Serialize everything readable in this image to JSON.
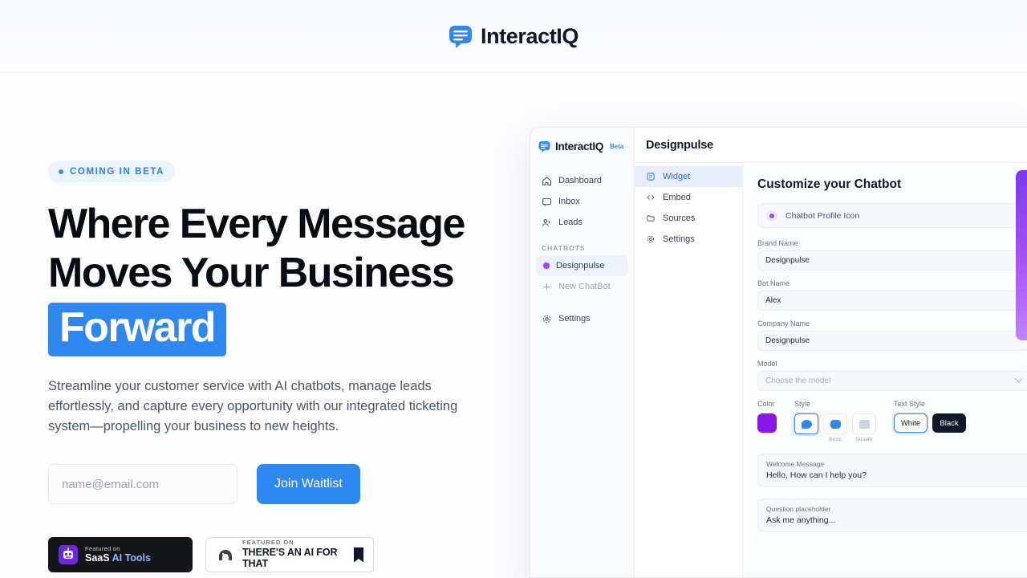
{
  "header": {
    "brand_name": "InteractIQ",
    "logo_icon": "chat-bubble-logo-icon",
    "logo_color": "#2f88f0"
  },
  "hero": {
    "badge": {
      "label": "COMING IN BETA",
      "dot_color": "#3b8ef0",
      "bg_color": "#eaf3fe",
      "text_color": "#2f7fe4"
    },
    "headline_line1": "Where Every Message",
    "headline_line2": "Moves Your Business",
    "headline_highlight": "Forward",
    "highlight_color": "#2f88f0",
    "subheadline": "Streamline your customer service with AI chatbots, manage leads effortlessly, and capture every opportunity with our integrated ticketing system—propelling your business to new heights.",
    "email_placeholder": "name@email.com",
    "email_value": "",
    "cta_label": "Join Waitlist",
    "cta_color": "#2f88f0"
  },
  "badges": [
    {
      "id": "saas-ai-tools",
      "icon": "robot-icon",
      "top_text": "Featured on",
      "main_text": "SaaS",
      "accent_text": "AI Tools",
      "theme": "dark"
    },
    {
      "id": "theres-an-ai-for-that",
      "icon": "elephant-icon",
      "top_text": "FEATURED ON",
      "main_text": "THERE'S AN AI FOR THAT",
      "theme": "light",
      "bookmark_icon": "bookmark-icon"
    }
  ],
  "app_preview": {
    "brand_name": "InteractIQ",
    "brand_badge": "Beta",
    "logo_icon": "chat-bubble-logo-icon",
    "sidebar": {
      "items": [
        {
          "label": "Dashboard",
          "icon": "home-icon",
          "state": "default"
        },
        {
          "label": "Inbox",
          "icon": "inbox-icon",
          "state": "default"
        },
        {
          "label": "Leads",
          "icon": "users-icon",
          "state": "default"
        }
      ],
      "group_label": "CHATBOTS",
      "chatbots": [
        {
          "label": "Designpulse",
          "icon": "chatbot-dot-icon",
          "state": "active"
        },
        {
          "label": "New ChatBot",
          "icon": "plus-icon",
          "state": "muted"
        }
      ],
      "footer_item": {
        "label": "Settings",
        "icon": "gear-icon"
      }
    },
    "topbar": {
      "title": "Designpulse"
    },
    "subnav": [
      {
        "label": "Widget",
        "icon": "widget-icon",
        "state": "active"
      },
      {
        "label": "Embed",
        "icon": "code-icon",
        "state": "default"
      },
      {
        "label": "Sources",
        "icon": "folder-icon",
        "state": "default"
      },
      {
        "label": "Settings",
        "icon": "gear-icon",
        "state": "default"
      }
    ],
    "main": {
      "title": "Customize your Chatbot",
      "profile_row_label": "Chatbot Profile Icon",
      "fields": [
        {
          "label": "Brand Name",
          "value": "Designpulse",
          "placeholder": ""
        },
        {
          "label": "Bot Name",
          "value": "Alex",
          "placeholder": ""
        },
        {
          "label": "Company Name",
          "value": "Designpulse",
          "placeholder": ""
        }
      ],
      "model_field": {
        "label": "Model",
        "value": "",
        "placeholder": "Choose the model"
      },
      "color_label": "Color",
      "color_value": "#8b16e8",
      "style_label": "Style",
      "style_options": [
        {
          "caption": "",
          "selected": true
        },
        {
          "caption": "Basic",
          "selected": false
        },
        {
          "caption": "Square",
          "selected": false
        }
      ],
      "text_style_label": "Text Style",
      "text_style_options": [
        {
          "label": "White",
          "selected": true
        },
        {
          "label": "Black",
          "selected": false
        }
      ],
      "welcome": {
        "label": "Welcome Message",
        "value": "Hello, How can I help you?"
      },
      "question": {
        "label": "Question placeholder",
        "value": "Ask me anything..."
      }
    }
  },
  "accent_strip": {
    "name": "purple-gradient-strip",
    "from": "#7c3aed",
    "to": "#c084fc"
  }
}
